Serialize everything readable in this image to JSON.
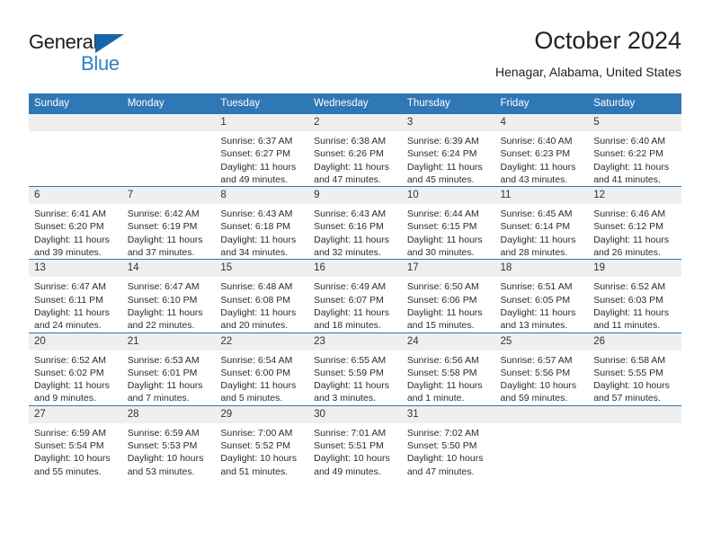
{
  "brand": {
    "name_part1": "General",
    "name_part2": "Blue",
    "triangle_color": "#1565a8",
    "blue_color": "#2e82c8"
  },
  "header": {
    "title": "October 2024",
    "subtitle": "Henagar, Alabama, United States"
  },
  "theme": {
    "header_blue": "#3077b5",
    "daynum_gray": "#efefef",
    "text": "#2b2b2b"
  },
  "calendar": {
    "weekday_headers": [
      "Sunday",
      "Monday",
      "Tuesday",
      "Wednesday",
      "Thursday",
      "Friday",
      "Saturday"
    ],
    "labels": {
      "sunrise": "Sunrise:",
      "sunset": "Sunset:",
      "daylight": "Daylight:"
    },
    "weeks": [
      [
        {
          "day": "",
          "empty": true
        },
        {
          "day": "",
          "empty": true
        },
        {
          "day": "1",
          "sunrise": "Sunrise: 6:37 AM",
          "sunset": "Sunset: 6:27 PM",
          "daylight": "Daylight: 11 hours and 49 minutes."
        },
        {
          "day": "2",
          "sunrise": "Sunrise: 6:38 AM",
          "sunset": "Sunset: 6:26 PM",
          "daylight": "Daylight: 11 hours and 47 minutes."
        },
        {
          "day": "3",
          "sunrise": "Sunrise: 6:39 AM",
          "sunset": "Sunset: 6:24 PM",
          "daylight": "Daylight: 11 hours and 45 minutes."
        },
        {
          "day": "4",
          "sunrise": "Sunrise: 6:40 AM",
          "sunset": "Sunset: 6:23 PM",
          "daylight": "Daylight: 11 hours and 43 minutes."
        },
        {
          "day": "5",
          "sunrise": "Sunrise: 6:40 AM",
          "sunset": "Sunset: 6:22 PM",
          "daylight": "Daylight: 11 hours and 41 minutes."
        }
      ],
      [
        {
          "day": "6",
          "sunrise": "Sunrise: 6:41 AM",
          "sunset": "Sunset: 6:20 PM",
          "daylight": "Daylight: 11 hours and 39 minutes."
        },
        {
          "day": "7",
          "sunrise": "Sunrise: 6:42 AM",
          "sunset": "Sunset: 6:19 PM",
          "daylight": "Daylight: 11 hours and 37 minutes."
        },
        {
          "day": "8",
          "sunrise": "Sunrise: 6:43 AM",
          "sunset": "Sunset: 6:18 PM",
          "daylight": "Daylight: 11 hours and 34 minutes."
        },
        {
          "day": "9",
          "sunrise": "Sunrise: 6:43 AM",
          "sunset": "Sunset: 6:16 PM",
          "daylight": "Daylight: 11 hours and 32 minutes."
        },
        {
          "day": "10",
          "sunrise": "Sunrise: 6:44 AM",
          "sunset": "Sunset: 6:15 PM",
          "daylight": "Daylight: 11 hours and 30 minutes."
        },
        {
          "day": "11",
          "sunrise": "Sunrise: 6:45 AM",
          "sunset": "Sunset: 6:14 PM",
          "daylight": "Daylight: 11 hours and 28 minutes."
        },
        {
          "day": "12",
          "sunrise": "Sunrise: 6:46 AM",
          "sunset": "Sunset: 6:12 PM",
          "daylight": "Daylight: 11 hours and 26 minutes."
        }
      ],
      [
        {
          "day": "13",
          "sunrise": "Sunrise: 6:47 AM",
          "sunset": "Sunset: 6:11 PM",
          "daylight": "Daylight: 11 hours and 24 minutes."
        },
        {
          "day": "14",
          "sunrise": "Sunrise: 6:47 AM",
          "sunset": "Sunset: 6:10 PM",
          "daylight": "Daylight: 11 hours and 22 minutes."
        },
        {
          "day": "15",
          "sunrise": "Sunrise: 6:48 AM",
          "sunset": "Sunset: 6:08 PM",
          "daylight": "Daylight: 11 hours and 20 minutes."
        },
        {
          "day": "16",
          "sunrise": "Sunrise: 6:49 AM",
          "sunset": "Sunset: 6:07 PM",
          "daylight": "Daylight: 11 hours and 18 minutes."
        },
        {
          "day": "17",
          "sunrise": "Sunrise: 6:50 AM",
          "sunset": "Sunset: 6:06 PM",
          "daylight": "Daylight: 11 hours and 15 minutes."
        },
        {
          "day": "18",
          "sunrise": "Sunrise: 6:51 AM",
          "sunset": "Sunset: 6:05 PM",
          "daylight": "Daylight: 11 hours and 13 minutes."
        },
        {
          "day": "19",
          "sunrise": "Sunrise: 6:52 AM",
          "sunset": "Sunset: 6:03 PM",
          "daylight": "Daylight: 11 hours and 11 minutes."
        }
      ],
      [
        {
          "day": "20",
          "sunrise": "Sunrise: 6:52 AM",
          "sunset": "Sunset: 6:02 PM",
          "daylight": "Daylight: 11 hours and 9 minutes."
        },
        {
          "day": "21",
          "sunrise": "Sunrise: 6:53 AM",
          "sunset": "Sunset: 6:01 PM",
          "daylight": "Daylight: 11 hours and 7 minutes."
        },
        {
          "day": "22",
          "sunrise": "Sunrise: 6:54 AM",
          "sunset": "Sunset: 6:00 PM",
          "daylight": "Daylight: 11 hours and 5 minutes."
        },
        {
          "day": "23",
          "sunrise": "Sunrise: 6:55 AM",
          "sunset": "Sunset: 5:59 PM",
          "daylight": "Daylight: 11 hours and 3 minutes."
        },
        {
          "day": "24",
          "sunrise": "Sunrise: 6:56 AM",
          "sunset": "Sunset: 5:58 PM",
          "daylight": "Daylight: 11 hours and 1 minute."
        },
        {
          "day": "25",
          "sunrise": "Sunrise: 6:57 AM",
          "sunset": "Sunset: 5:56 PM",
          "daylight": "Daylight: 10 hours and 59 minutes."
        },
        {
          "day": "26",
          "sunrise": "Sunrise: 6:58 AM",
          "sunset": "Sunset: 5:55 PM",
          "daylight": "Daylight: 10 hours and 57 minutes."
        }
      ],
      [
        {
          "day": "27",
          "sunrise": "Sunrise: 6:59 AM",
          "sunset": "Sunset: 5:54 PM",
          "daylight": "Daylight: 10 hours and 55 minutes."
        },
        {
          "day": "28",
          "sunrise": "Sunrise: 6:59 AM",
          "sunset": "Sunset: 5:53 PM",
          "daylight": "Daylight: 10 hours and 53 minutes."
        },
        {
          "day": "29",
          "sunrise": "Sunrise: 7:00 AM",
          "sunset": "Sunset: 5:52 PM",
          "daylight": "Daylight: 10 hours and 51 minutes."
        },
        {
          "day": "30",
          "sunrise": "Sunrise: 7:01 AM",
          "sunset": "Sunset: 5:51 PM",
          "daylight": "Daylight: 10 hours and 49 minutes."
        },
        {
          "day": "31",
          "sunrise": "Sunrise: 7:02 AM",
          "sunset": "Sunset: 5:50 PM",
          "daylight": "Daylight: 10 hours and 47 minutes."
        },
        {
          "day": "",
          "empty": true
        },
        {
          "day": "",
          "empty": true
        }
      ]
    ]
  }
}
